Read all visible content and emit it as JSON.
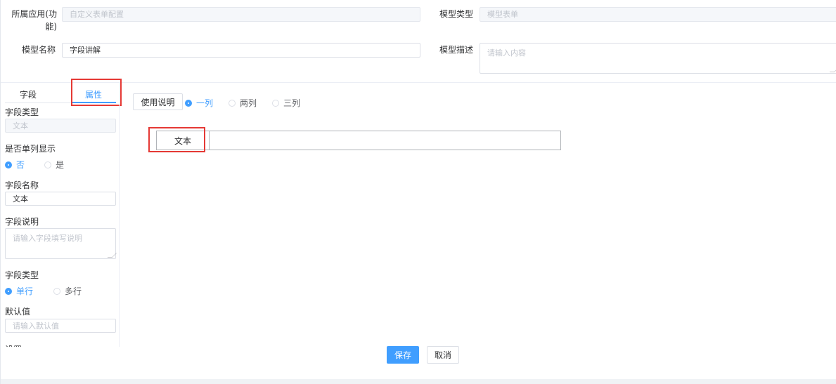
{
  "header": {
    "app_label": "所属应用(功能)",
    "app_label_line1": "所属应用(功",
    "app_label_line2": "能)",
    "app_value": "自定义表单配置",
    "model_type_label": "模型类型",
    "model_type_value": "模型表单",
    "model_name_label": "模型名称",
    "model_name_value": "字段讲解",
    "model_desc_label": "模型描述",
    "model_desc_placeholder": "请输入内容"
  },
  "left_panel": {
    "tabs": [
      {
        "label": "字段",
        "active": false
      },
      {
        "label": "属性",
        "active": true
      }
    ],
    "field_type_label": "字段类型",
    "field_type_value": "文本",
    "single_col_label": "是否单列显示",
    "single_col_options": [
      {
        "label": "否",
        "selected": true
      },
      {
        "label": "是",
        "selected": false
      }
    ],
    "field_name_label": "字段名称",
    "field_name_value": "文本",
    "field_desc_label": "字段说明",
    "field_desc_placeholder": "请输入字段填写说明",
    "line_type_label": "字段类型",
    "line_type_options": [
      {
        "label": "单行",
        "selected": true
      },
      {
        "label": "多行",
        "selected": false
      }
    ],
    "default_label": "默认值",
    "default_placeholder": "请输入默认值",
    "cut_label": "设置"
  },
  "canvas": {
    "usage_button": "使用说明",
    "layout_options": [
      {
        "label": "一列",
        "selected": true
      },
      {
        "label": "两列",
        "selected": false
      },
      {
        "label": "三列",
        "selected": false
      }
    ],
    "preview_field_label": "文本",
    "preview_field_value": ""
  },
  "footer": {
    "save_label": "保存",
    "cancel_label": "取消"
  },
  "colors": {
    "accent": "#409eff",
    "highlight_box": "#e53935",
    "border": "#dcdfe6"
  }
}
